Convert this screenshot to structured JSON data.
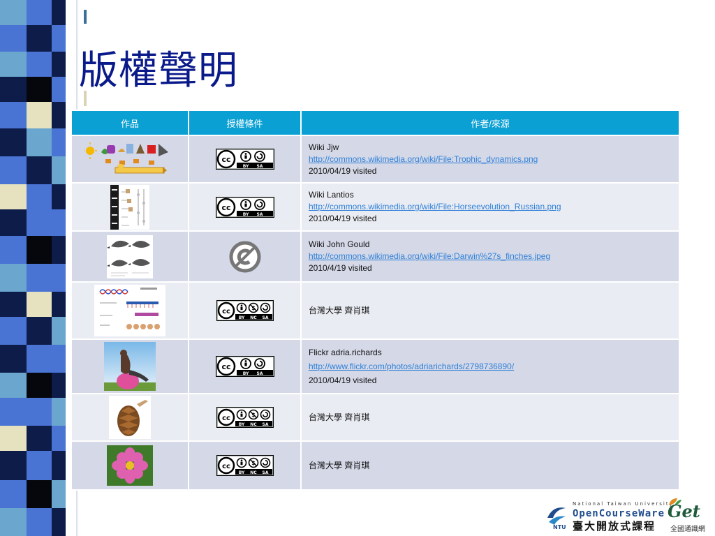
{
  "slide": {
    "title": "版權聲明"
  },
  "table": {
    "headers": [
      "作品",
      "授權條件",
      "作者/來源"
    ],
    "rows": [
      {
        "work_image": "trophic-dynamics-diagram",
        "license": "cc-by-sa",
        "author": "Wiki Jjw",
        "link": "http://commons.wikimedia.org/wiki/File:Trophic_dynamics.png",
        "visited": "2010/04/19 visited"
      },
      {
        "work_image": "horse-evolution-chart",
        "license": "cc-by-sa",
        "author": "Wiki Lantios",
        "link": "http://commons.wikimedia.org/wiki/File:Horseevolution_Russian.png",
        "visited": "2010/04/19 visited"
      },
      {
        "work_image": "darwin-finches-drawing",
        "license": "public-domain",
        "author": "Wiki John Gould",
        "link": "http://commons.wikimedia.org/wiki/File:Darwin%27s_finches.jpeg",
        "visited": "2010/4/19 visited"
      },
      {
        "work_image": "dna-transcription-diagram",
        "license": "cc-by-nc-sa",
        "author": "台灣大學 齊肖琪"
      },
      {
        "work_image": "woman-on-exercise-ball-photo",
        "license": "cc-by-sa",
        "author": "Flickr adria.richards",
        "link": "http://www.flickr.com/photos/adriarichards/2798736890/",
        "visited": "2010/04/19 visited"
      },
      {
        "work_image": "pine-cone-photo",
        "license": "cc-by-nc-sa",
        "author": "台灣大學 齊肖琪"
      },
      {
        "work_image": "pink-cosmos-flower-photo",
        "license": "cc-by-nc-sa",
        "author": "台灣大學 齊肖琪"
      }
    ]
  },
  "license_badges": {
    "cc": "cc",
    "by": "BY",
    "nc": "NC",
    "sa": "SA"
  },
  "footer": {
    "ocw_line1": "National Taiwan University",
    "ocw_line2": "OpenCourseWare",
    "ocw_line3": "臺大開放式課程",
    "ntu_mark": "NTU",
    "get_mark": "Get",
    "get_caption": "全國通識網"
  },
  "colors": {
    "title": "#0a1a8a",
    "header_bg": "#0aa0d3",
    "row_dark": "#d4d8e7",
    "row_light": "#eaecf3",
    "link": "#2f80d8",
    "strip_blue": "#4a74d4",
    "strip_navy": "#0e1c4a",
    "strip_sky": "#6aa6ce",
    "strip_cream": "#e6e2bf",
    "strip_black": "#05070c"
  }
}
